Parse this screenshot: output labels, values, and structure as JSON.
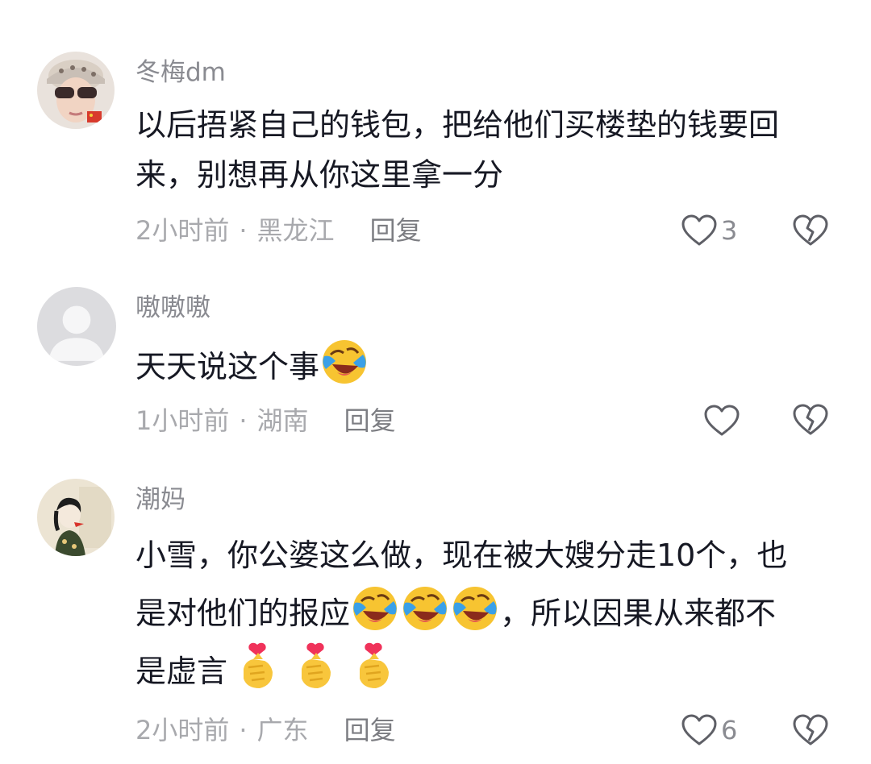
{
  "comments": [
    {
      "username": "冬梅dm",
      "text_lines": [
        "以后捂紧自己的钱包，把给他们买楼垫的钱要回",
        "来，别想再从你这里拿一分"
      ],
      "time": "2小时前",
      "location": "黑龙江",
      "reply_label": "回复",
      "like_count": "3"
    },
    {
      "username": "嗷嗷嗷",
      "text_line_1": "天天说这个事",
      "text_emoji": "laughing-crying-emoji",
      "time": "1小时前",
      "location": "湖南",
      "reply_label": "回复",
      "like_count": ""
    },
    {
      "username": "潮妈",
      "text_line_1": "小雪，你公婆这么做，现在被大嫂分走10个，也",
      "text_line_2_a": "是对他们的报应",
      "text_line_2_b": "，所以因果从来都不",
      "text_line_3": "是虚言",
      "time": "2小时前",
      "location": "广东",
      "reply_label": "回复",
      "like_count": "6"
    }
  ],
  "colors": {
    "text": "#161823",
    "username": "#8a8b91",
    "meta": "#a8a9ad",
    "icon_stroke": "#5e5f66"
  },
  "icons": [
    "heart-outline-icon",
    "broken-heart-icon",
    "laughing-crying-emoji",
    "finger-heart-emoji"
  ]
}
